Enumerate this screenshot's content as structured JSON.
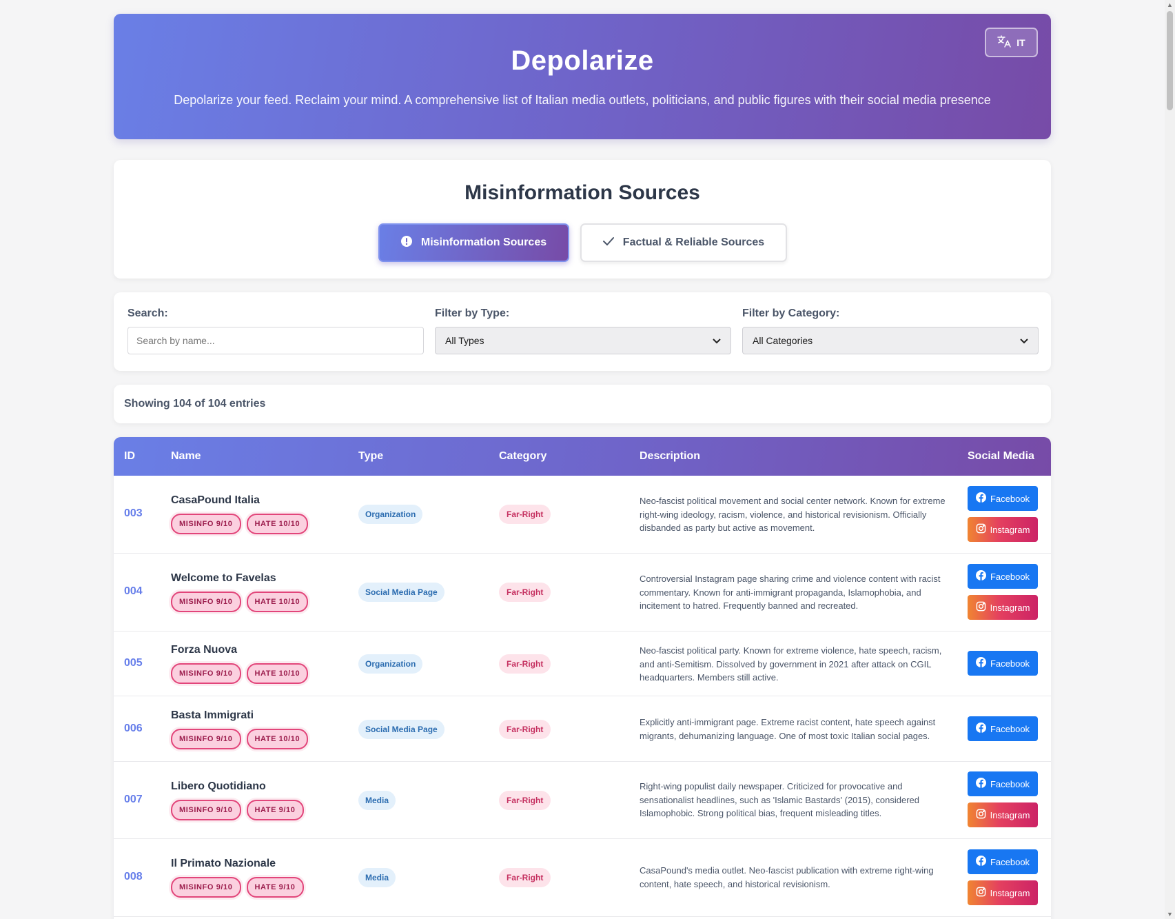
{
  "header": {
    "title": "Depolarize",
    "subtitle": "Depolarize your feed. Reclaim your mind. A comprehensive list of Italian media outlets, politicians, and public figures with their social media presence",
    "lang_button": "IT"
  },
  "section": {
    "title": "Misinformation Sources",
    "tabs": [
      {
        "label": "Misinformation Sources",
        "active": true
      },
      {
        "label": "Factual & Reliable Sources",
        "active": false
      }
    ]
  },
  "filters": {
    "search_label": "Search:",
    "search_placeholder": "Search by name...",
    "type_label": "Filter by Type:",
    "type_value": "All Types",
    "category_label": "Filter by Category:",
    "category_value": "All Categories"
  },
  "count_text": "Showing 104 of 104 entries",
  "table": {
    "headers": [
      "ID",
      "Name",
      "Type",
      "Category",
      "Description",
      "Social Media"
    ],
    "rows": [
      {
        "id": "003",
        "name": "CasaPound Italia",
        "misinfo": "MISINFO 9/10",
        "hate": "HATE 10/10",
        "type": "Organization",
        "category": "Far-Right",
        "description": "Neo-fascist political movement and social center network. Known for extreme right-wing ideology, racism, violence, and historical revisionism. Officially disbanded as party but active as movement.",
        "social": [
          "Facebook",
          "Instagram"
        ]
      },
      {
        "id": "004",
        "name": "Welcome to Favelas",
        "misinfo": "MISINFO 9/10",
        "hate": "HATE 10/10",
        "type": "Social Media Page",
        "category": "Far-Right",
        "description": "Controversial Instagram page sharing crime and violence content with racist commentary. Known for anti-immigrant propaganda, Islamophobia, and incitement to hatred. Frequently banned and recreated.",
        "social": [
          "Facebook",
          "Instagram"
        ]
      },
      {
        "id": "005",
        "name": "Forza Nuova",
        "misinfo": "MISINFO 9/10",
        "hate": "HATE 10/10",
        "type": "Organization",
        "category": "Far-Right",
        "description": "Neo-fascist political party. Known for extreme violence, hate speech, racism, and anti-Semitism. Dissolved by government in 2021 after attack on CGIL headquarters. Members still active.",
        "social": [
          "Facebook"
        ]
      },
      {
        "id": "006",
        "name": "Basta Immigrati",
        "misinfo": "MISINFO 9/10",
        "hate": "HATE 10/10",
        "type": "Social Media Page",
        "category": "Far-Right",
        "description": "Explicitly anti-immigrant page. Extreme racist content, hate speech against migrants, dehumanizing language. One of most toxic Italian social pages.",
        "social": [
          "Facebook"
        ]
      },
      {
        "id": "007",
        "name": "Libero Quotidiano",
        "misinfo": "MISINFO 9/10",
        "hate": "HATE 9/10",
        "type": "Media",
        "category": "Far-Right",
        "description": "Right-wing populist daily newspaper. Criticized for provocative and sensationalist headlines, such as 'Islamic Bastards' (2015), considered Islamophobic. Strong political bias, frequent misleading titles.",
        "social": [
          "Facebook",
          "Instagram"
        ]
      },
      {
        "id": "008",
        "name": "Il Primato Nazionale",
        "misinfo": "MISINFO 9/10",
        "hate": "HATE 9/10",
        "type": "Media",
        "category": "Far-Right",
        "description": "CasaPound's media outlet. Neo-fascist publication with extreme right-wing content, hate speech, and historical revisionism.",
        "social": [
          "Facebook",
          "Instagram"
        ]
      }
    ]
  }
}
